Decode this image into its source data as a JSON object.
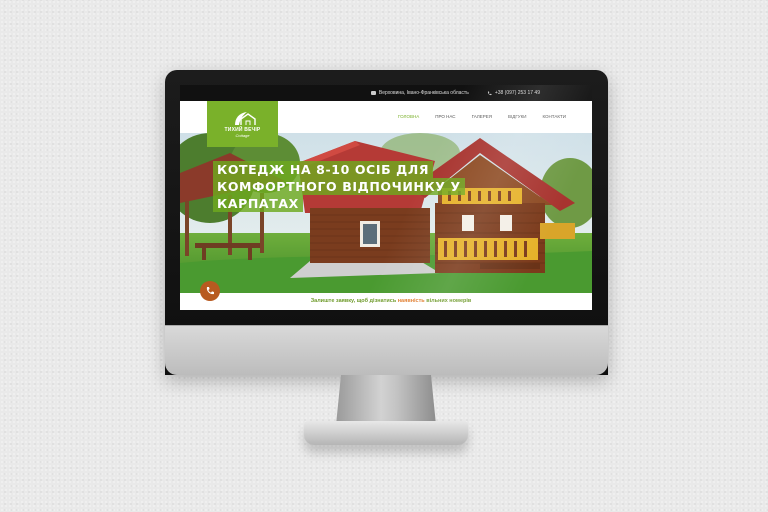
{
  "topbar": {
    "address": "Верховина, Івано-Франківська область",
    "phone": "+38 (097) 253 17 49",
    "address_icon": "mail-icon",
    "phone_icon": "phone-icon"
  },
  "logo": {
    "name": "ТИХИЙ ВЕЧІР",
    "subtitle": "Cottage",
    "color": "#7ab12a"
  },
  "menu": {
    "items": [
      {
        "label": "ГОЛОВНА",
        "active": true
      },
      {
        "label": "ПРО НАС",
        "active": false
      },
      {
        "label": "ГАЛЕРЕЯ",
        "active": false
      },
      {
        "label": "ВІДГУКИ",
        "active": false
      },
      {
        "label": "КОНТАКТИ",
        "active": false
      }
    ]
  },
  "hero": {
    "title_line1": "КОТЕДЖ НА 8-10 ОСІБ ДЛЯ",
    "title_line2": "КОМФОРТНОГО ВІДПОЧИНКУ У КАРПАТАХ"
  },
  "cta": {
    "text_before": "Залиште заявку, щоб дізнатись ",
    "text_accent": "наявність",
    "text_after": " вільних номерів"
  },
  "colors": {
    "accent_green": "#7ab12a",
    "call_button": "#b85a20",
    "cta_accent": "#e07a2a"
  }
}
